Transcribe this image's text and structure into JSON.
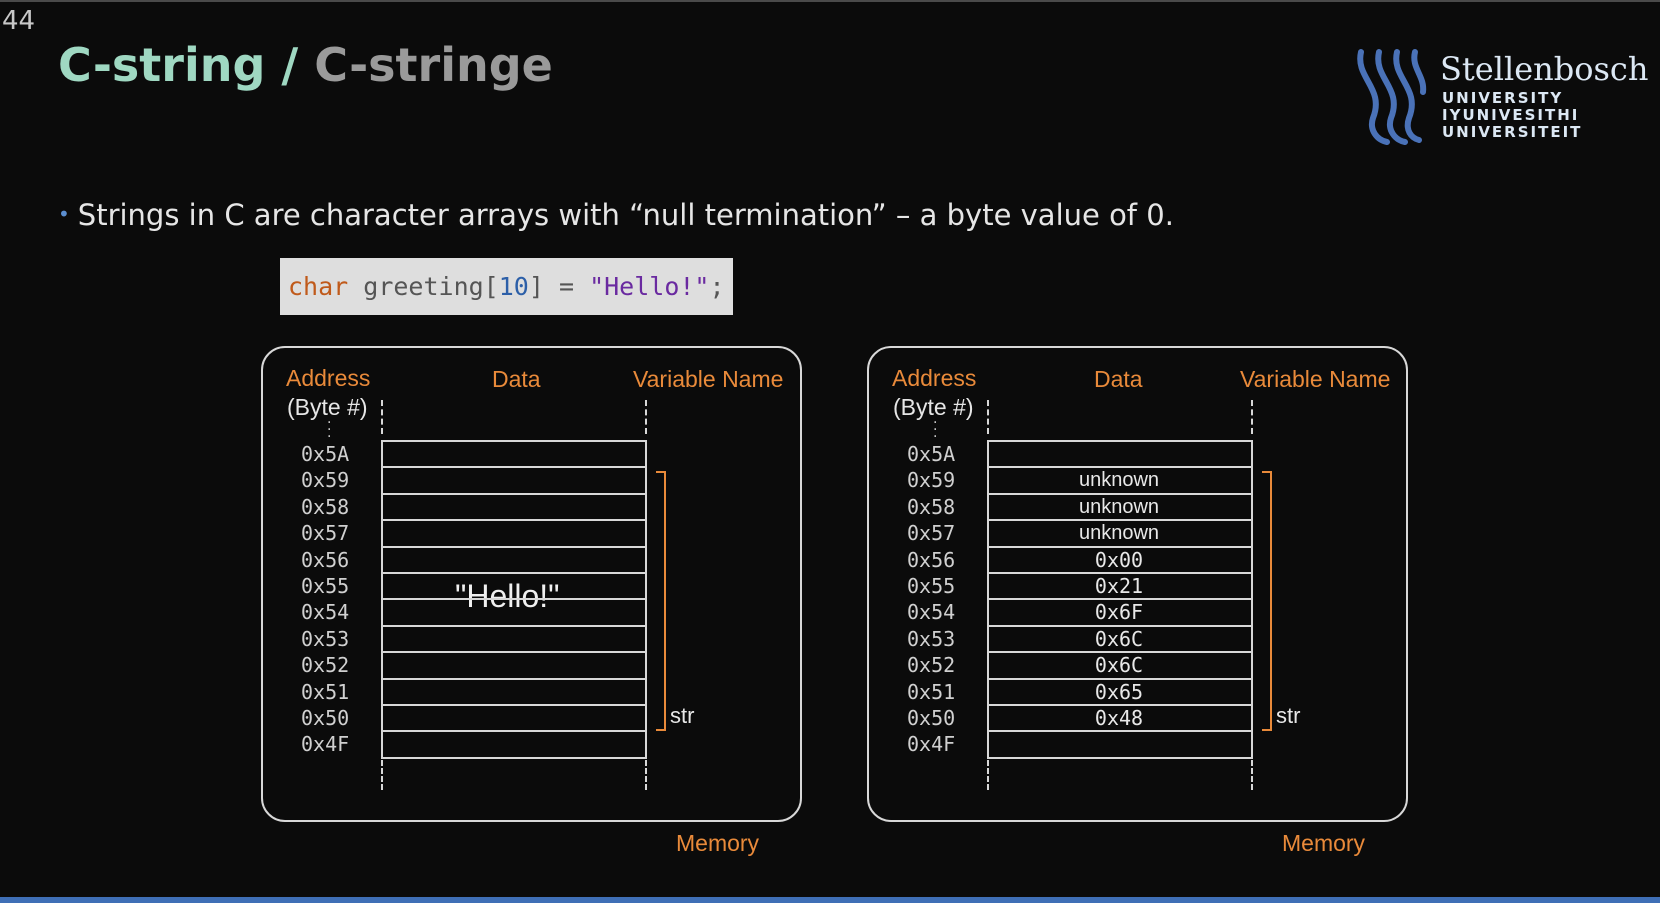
{
  "slide_number": "44",
  "title": {
    "english": "C-string",
    "separator": " / ",
    "afrikaans": "C-stringe"
  },
  "logo": {
    "name": "Stellenbosch",
    "line1": "UNIVERSITY",
    "line2": "IYUNIVESITHI",
    "line3": "UNIVERSITEIT"
  },
  "bullet": "Strings in C are character arrays with “null termination” – a byte value of 0.",
  "code": {
    "type": "char",
    "name": " greeting[",
    "size": "10",
    "mid": "] = ",
    "value": "\"Hello!\"",
    "end": ";"
  },
  "diagram": {
    "header_address": "Address",
    "header_byte": "(Byte #)",
    "header_data": "Data",
    "header_varname": "Variable Name",
    "variable": "str",
    "footer": "Memory",
    "addresses": [
      "0x5A",
      "0x59",
      "0x58",
      "0x57",
      "0x56",
      "0x55",
      "0x54",
      "0x53",
      "0x52",
      "0x51",
      "0x50",
      "0x4F"
    ],
    "left_data_label": "\"Hello!\"",
    "right_cells": [
      "",
      "unknown",
      "unknown",
      "unknown",
      "0x00",
      "0x21",
      "0x6F",
      "0x6C",
      "0x6C",
      "0x65",
      "0x48",
      ""
    ],
    "bracket_color": "#e98a3a"
  },
  "colors": {
    "title_en": "#9fd8c2",
    "title_af": "#9a9a9a",
    "accent_orange": "#e98a3a",
    "bottom_bar": "#3f6fb6"
  }
}
